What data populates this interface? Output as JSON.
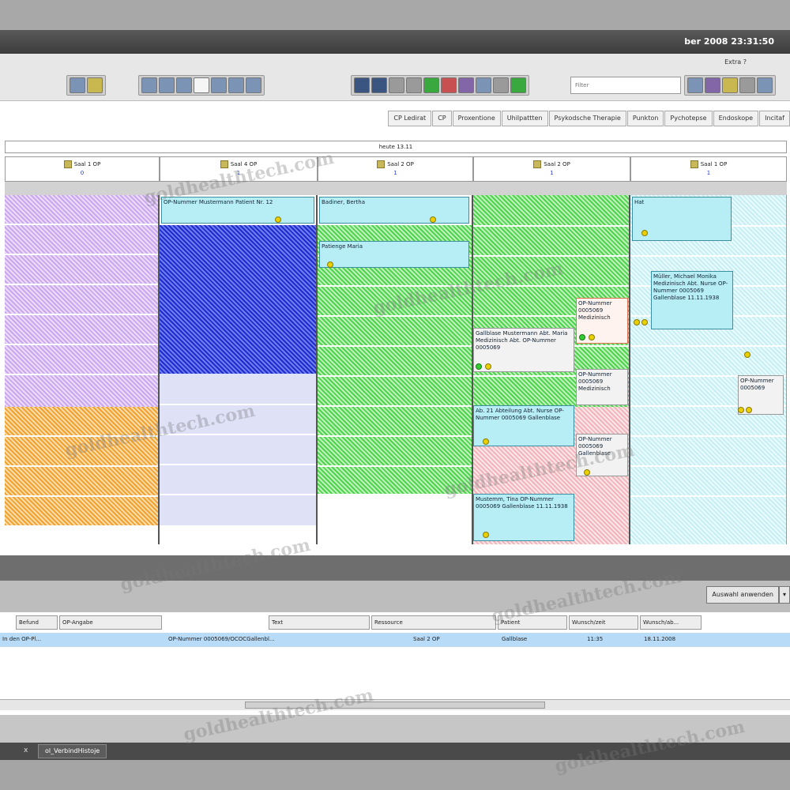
{
  "window": {
    "title": "ber 2008   23:31:50"
  },
  "menu": {
    "edit": "Extra    ?"
  },
  "search": {
    "placeholder": "Filter"
  },
  "tabs": [
    "CP Ledirat",
    "CP",
    "Proxentione",
    "Uhilpattten",
    "Psykodsche Therapie",
    "Punkton",
    "Pychotepse",
    "Endoskope",
    "Incitaf"
  ],
  "schedule": {
    "day_label": "heute 13.11",
    "columns": [
      {
        "title": "Saal 1 OP",
        "count": "0"
      },
      {
        "title": "Saal 4 OP",
        "count": "1"
      },
      {
        "title": "Saal 2 OP",
        "count": "1"
      },
      {
        "title": "Saal 2 OP",
        "count": "1"
      },
      {
        "title": "Saal 1 OP",
        "count": "1"
      }
    ],
    "appointments": [
      {
        "text": "OP-Nummer Mustermann Patient Nr. 12"
      },
      {
        "text": "Badiner, Bertha"
      },
      {
        "text": "Patienge Maria"
      },
      {
        "text": "Hat"
      },
      {
        "text": "Müller, Michael Monika Medizinisch Abt. Nurse OP-Nummer 0005069 Gallenblase 11.11.1938"
      },
      {
        "text": "OP-Nummer 0005069 Medizinisch"
      },
      {
        "text": "Gallblase Mustermann Abt. Maria Medizinisch Abt. OP-Nummer 0005069"
      },
      {
        "text": "OP-Nummer 0005069 Medizinisch"
      },
      {
        "text": "Ab. 21 Abteilung Abt. Nurse OP-Nummer 0005069 Gallenblase"
      },
      {
        "text": "OP-Nummer 0005069 Gallenblase"
      },
      {
        "text": "Mustemm, Tina OP-Nummer 0005069 Gallenblase 11.11.1938"
      },
      {
        "text": "OP-Nummer 0005069"
      }
    ]
  },
  "lower": {
    "select_label": "Auswahl anwenden"
  },
  "table": {
    "headers": [
      "Wunsch/ab...",
      "Wunsch/zeit",
      "Patient",
      "Ressource",
      "Text",
      "OP-Angabe",
      "Befund"
    ],
    "row": [
      "18.11.2008",
      "11:35",
      "Gallblase",
      "Saal 2 OP",
      "OP-Nummer 0005069/OCOCGallenbl...",
      "",
      "In den OP-Pl..."
    ]
  },
  "status": {
    "tab_label": "ol_VerbindHistoje",
    "close": "x"
  },
  "watermark": "goldhealthtech.com"
}
